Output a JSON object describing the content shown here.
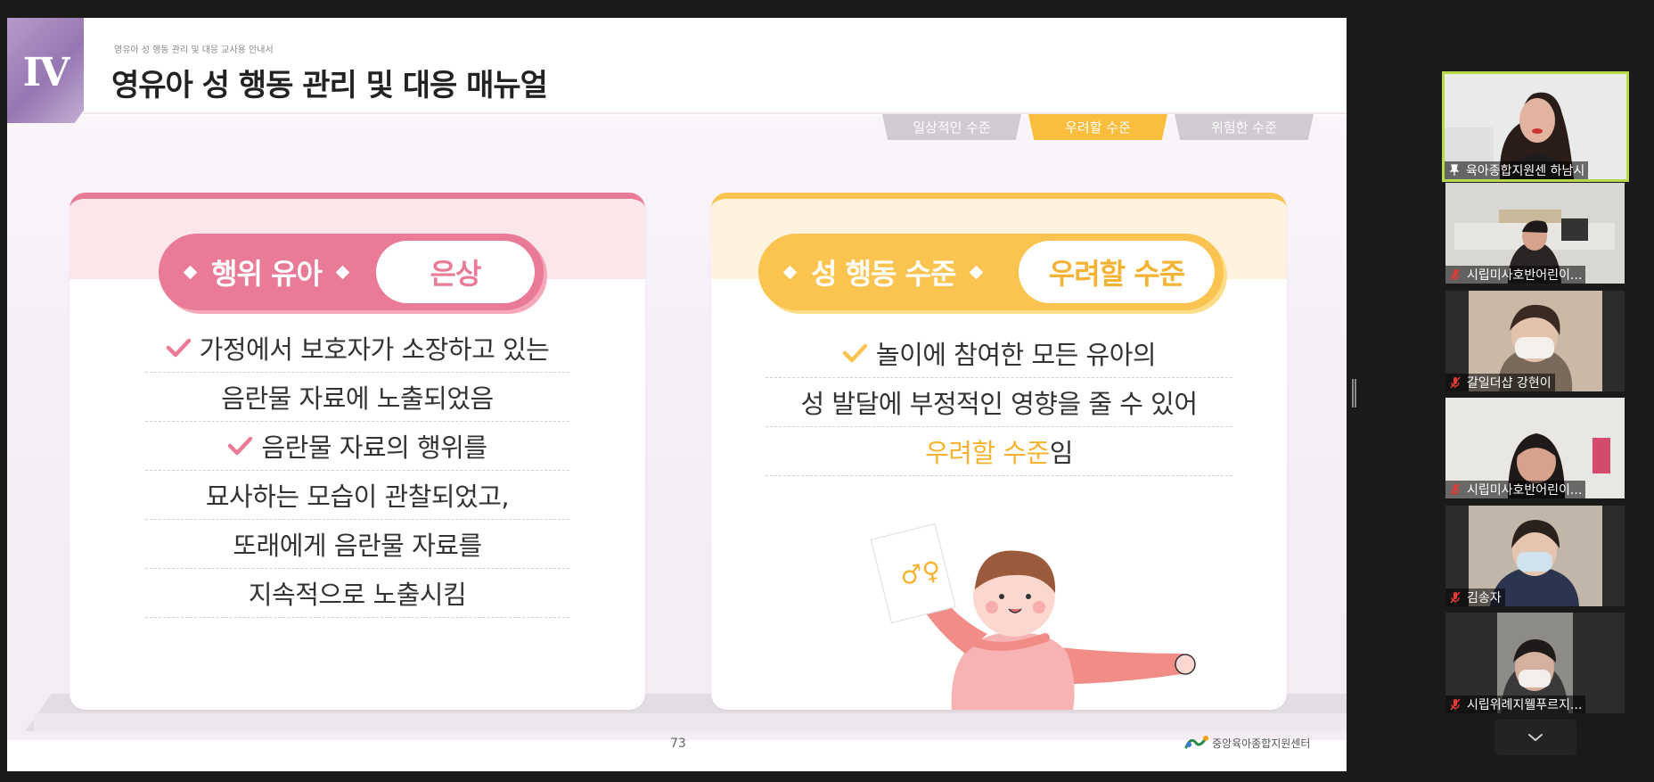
{
  "slide": {
    "chapter": "IV",
    "kicker": "영유아 성 행동 관리 및 대응 교사용 안내서",
    "title": "영유아 성 행동 관리 및 대응 매뉴얼",
    "level_tabs": [
      "일상적인 수준",
      "우려할 수준",
      "위험한 수준"
    ],
    "active_level": "우려할 수준",
    "left_card": {
      "pill_left": "행위 유아",
      "pill_right": "은상",
      "lines": [
        "가정에서 보호자가 소장하고 있는",
        "음란물 자료에 노출되었음",
        "음란물 자료의 행위를",
        "묘사하는 모습이 관찰되었고,",
        "또래에게 음란물 자료를",
        "지속적으로 노출시킴"
      ]
    },
    "right_card": {
      "pill_left": "성 행동 수준",
      "pill_right": "우려할 수준",
      "lines": [
        "놀이에 참여한 모든 유아의",
        "성 발달에 부정적인 영향을 줄 수 있어"
      ],
      "last_line_highlight": "우려할 수준",
      "last_line_suffix": "임",
      "illustration_symbol": "♂♀"
    },
    "page_number": "73",
    "org_name": "중앙육아종합지원센터",
    "colors": {
      "pink": "#ea7b96",
      "yellow": "#fbc450",
      "purple": "#9677b3"
    }
  },
  "participants": [
    {
      "name": "육아종합지원센 하남시",
      "icon": "pin-icon",
      "speaking": true
    },
    {
      "name": "시립미사호반어린이...",
      "icon": "mic-muted-icon"
    },
    {
      "name": "갈일더샵 강현이",
      "icon": "mic-muted-icon"
    },
    {
      "name": "시립미사호반어린이...",
      "icon": "mic-muted-icon"
    },
    {
      "name": "김송자",
      "icon": "mic-muted-icon"
    },
    {
      "name": "시립위례지웰푸르지...",
      "icon": "mic-muted-icon"
    }
  ],
  "controls": {
    "scroll_icon": "chevron-down-icon"
  }
}
